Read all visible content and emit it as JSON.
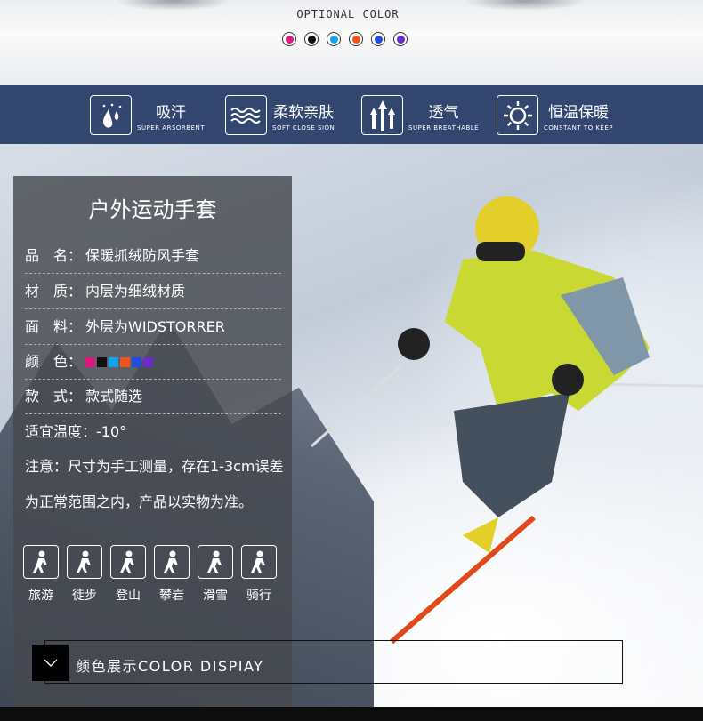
{
  "header": {
    "title": "OPTIONAL COLOR",
    "colors": [
      "#d81b7a",
      "#111111",
      "#12a3e8",
      "#f2521b",
      "#1f4fd8",
      "#6a2ad0"
    ]
  },
  "features": [
    {
      "icon": "water-drops-icon",
      "cn": "吸汗",
      "en": "SUPER ARSORBENT"
    },
    {
      "icon": "waves-icon",
      "cn": "柔软亲肤",
      "en": "SOFT CLOSE SION"
    },
    {
      "icon": "arrows-up-icon",
      "cn": "透气",
      "en": "SUPER BREATHABLE"
    },
    {
      "icon": "sun-icon",
      "cn": "恒温保暖",
      "en": "CONSTANT TO KEEP"
    }
  ],
  "panel": {
    "title": "户外运动手套",
    "rows": [
      {
        "k": "品　名：",
        "v": "保暖抓绒防风手套"
      },
      {
        "k": "材　质：",
        "v": "内层为细绒材质"
      },
      {
        "k": "面　料：",
        "v": "外层为WIDSTORRER"
      },
      {
        "k": "颜　色：",
        "v": ""
      },
      {
        "k": "款　式：",
        "v": "款式随选"
      }
    ],
    "temp": "适宜温度：-10°",
    "note1": "注意：尺寸为手工测量，存在1-3cm误差",
    "note2": "为正常范围之内，产品以实物为准。",
    "activities": [
      {
        "icon": "travel-icon",
        "label": "旅游"
      },
      {
        "icon": "hiking-icon",
        "label": "徒步"
      },
      {
        "icon": "mountaineering-icon",
        "label": "登山"
      },
      {
        "icon": "climbing-icon",
        "label": "攀岩"
      },
      {
        "icon": "skiing-icon",
        "label": "滑雪"
      },
      {
        "icon": "cycling-icon",
        "label": "骑行"
      }
    ]
  },
  "color_display": {
    "label": "颜色展示COLOR DISPIAY",
    "icon": "chevron-down-icon"
  }
}
